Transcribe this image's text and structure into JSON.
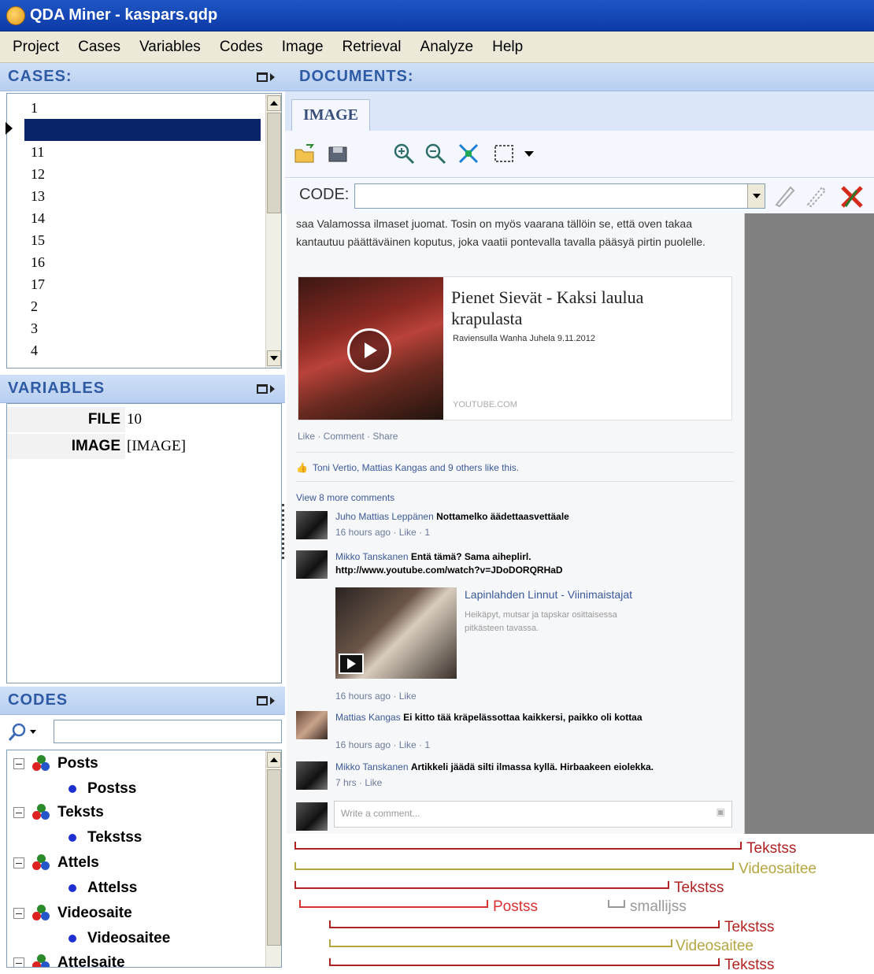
{
  "window": {
    "title": "QDA Miner - kaspars.qdp"
  },
  "menu": [
    "Project",
    "Cases",
    "Variables",
    "Codes",
    "Image",
    "Retrieval",
    "Analyze",
    "Help"
  ],
  "cases": {
    "header": "CASES:",
    "items": [
      "1",
      "10",
      "11",
      "12",
      "13",
      "14",
      "15",
      "16",
      "17",
      "2",
      "3",
      "4"
    ],
    "selected_index": 1
  },
  "variables": {
    "header": "VARIABLES",
    "rows": [
      {
        "name": "FILE",
        "value": "10"
      },
      {
        "name": "IMAGE",
        "value": "[IMAGE]"
      }
    ]
  },
  "codes": {
    "header": "CODES",
    "tree": [
      {
        "category": "Posts",
        "child": "Postss"
      },
      {
        "category": "Teksts",
        "child": "Tekstss"
      },
      {
        "category": "Attels",
        "child": "Attelss"
      },
      {
        "category": "Videosaite",
        "child": "Videosaitee"
      },
      {
        "category": "Attelsaite",
        "child": ""
      }
    ]
  },
  "documents": {
    "header": "DOCUMENTS:",
    "tab": "IMAGE",
    "code_label": "CODE:",
    "code_value": ""
  },
  "post": {
    "text": "saa Valamossa ilmaset juomat. Tosin on myös vaarana tällöin se, että oven takaa kantautuu päättäväinen koputus, joka vaatii pontevalla tavalla pääsyä pirtin puolelle.",
    "video_title": "Pienet Sievät - Kaksi laulua krapulasta",
    "video_sub": "Raviensulla Wanha Juhela 9.11.2012",
    "video_source": "YOUTUBE.COM",
    "actions": "Like · Comment · Share",
    "likes": "Toni Vertio, Mattias Kangas and 9 others like this.",
    "view_more": "View 8 more comments",
    "comments": [
      {
        "name": "Juho Mattias Leppänen",
        "text": "Nottamelko äädettaasvettäale",
        "meta": "16 hours ago · Like · 1"
      },
      {
        "name": "Mikko Tanskanen",
        "text": "Entä tämä? Sama aiheplirl. http://www.youtube.com/watch?v=JDoDORQRHaD",
        "meta": ""
      },
      {
        "name": "Mattias Kangas",
        "text": "Ei kitto tää kräpelässottaa kaikkersi, paikko oli kottaa",
        "meta": "16 hours ago · Like · 1"
      },
      {
        "name": "Mikko Tanskanen",
        "text": "Artikkeli jäädä silti ilmassa kyllä. Hirbaakeen eiolekka.",
        "meta": "7 hrs · Like"
      }
    ],
    "embed_title": "Lapinlahden Linnut - Viinimaistajat",
    "embed_sub": "Heikäpyt, mutsar ja tapskar osittaisessa pitkästeen tavassa.",
    "embed_meta": "16 hours ago · Like",
    "write_placeholder": "Write a comment..."
  },
  "coding_lines": [
    {
      "label": "Tekstss",
      "color": "#b22222"
    },
    {
      "label": "Videosaitee",
      "color": "#b5a642"
    },
    {
      "label": "Tekstss",
      "color": "#b22222"
    },
    {
      "label": "Postss",
      "color": "#d93030"
    },
    {
      "label": "smallijss",
      "color": "#999999"
    },
    {
      "label": "Tekstss",
      "color": "#b22222"
    },
    {
      "label": "Videosaitee",
      "color": "#b5a642"
    },
    {
      "label": "Tekstss",
      "color": "#b22222"
    }
  ]
}
